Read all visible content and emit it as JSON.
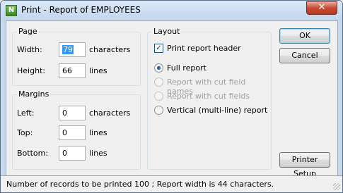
{
  "window": {
    "title": "Print - Report of EMPLOYEES",
    "app_icon_letter": "N",
    "close_glyph": "✕"
  },
  "page": {
    "title": "Page",
    "width_label": "Width:",
    "width_value": "79",
    "width_unit": "characters",
    "height_label": "Height:",
    "height_value": "66",
    "height_unit": "lines"
  },
  "margins": {
    "title": "Margins",
    "left_label": "Left:",
    "left_value": "0",
    "left_unit": "characters",
    "top_label": "Top:",
    "top_value": "0",
    "top_unit": "lines",
    "bottom_label": "Bottom:",
    "bottom_value": "0",
    "bottom_unit": "lines"
  },
  "layout": {
    "title": "Layout",
    "print_header_label": "Print report header",
    "print_header_checked": true,
    "options": [
      {
        "label": "Full report",
        "checked": true,
        "enabled": true
      },
      {
        "label": "Report with cut field names",
        "checked": false,
        "enabled": false
      },
      {
        "label": "Report with cut fields",
        "checked": false,
        "enabled": false
      },
      {
        "label": "Vertical (multi-line) report",
        "checked": false,
        "enabled": true
      }
    ]
  },
  "buttons": {
    "ok": "OK",
    "cancel": "Cancel",
    "printer_setup": "Printer Setup"
  },
  "status": {
    "text": "Number of records to be printed 100  ;  Report width is 44 characters."
  }
}
